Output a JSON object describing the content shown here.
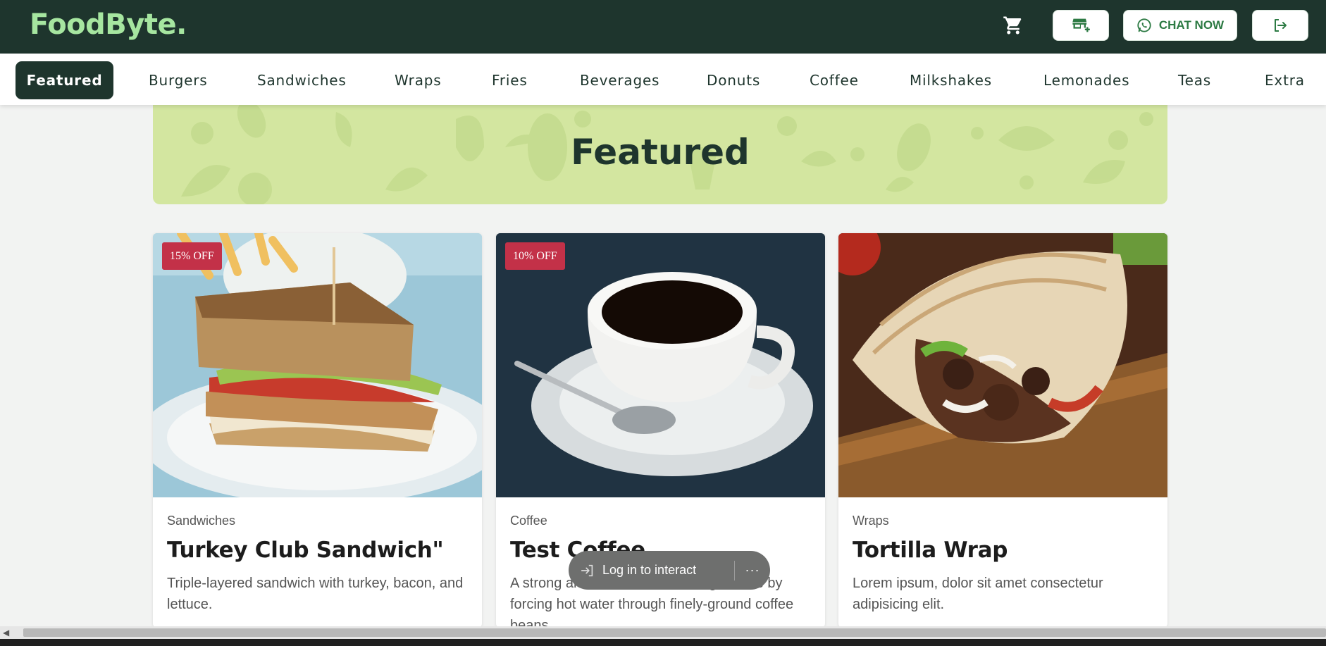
{
  "app": {
    "logo": "FoodByte.",
    "chat_label": "CHAT NOW",
    "icons": {
      "cart": "cart-icon",
      "store": "add-store-icon",
      "chat": "whatsapp-icon",
      "logout": "logout-icon"
    }
  },
  "categories": [
    {
      "label": "Featured",
      "active": true
    },
    {
      "label": "Burgers"
    },
    {
      "label": "Sandwiches"
    },
    {
      "label": "Wraps"
    },
    {
      "label": "Fries"
    },
    {
      "label": "Beverages"
    },
    {
      "label": "Donuts"
    },
    {
      "label": "Coffee"
    },
    {
      "label": "Milkshakes"
    },
    {
      "label": "Lemonades"
    },
    {
      "label": "Teas"
    },
    {
      "label": "Extra"
    }
  ],
  "hero": {
    "title": "Featured"
  },
  "products": [
    {
      "badge": "15% OFF",
      "category": "Sandwiches",
      "title": "Turkey Club Sandwich\"",
      "description": "Triple-layered sandwich with turkey, bacon, and lettuce."
    },
    {
      "badge": "10% OFF",
      "category": "Coffee",
      "title": "Test Coffee",
      "description": "A strong aromatic coffee beverage made by forcing hot water through finely-ground coffee beans."
    },
    {
      "badge": "",
      "category": "Wraps",
      "title": "Tortilla Wrap",
      "description": "Lorem ipsum, dolor sit amet consectetur adipisicing elit."
    }
  ],
  "login_prompt": {
    "label": "Log in to interact",
    "more": "···"
  },
  "colors": {
    "header_bg": "#1e352d",
    "logo": "#a6e6a0",
    "hero_bg": "#d3e6a0",
    "badge": "#c33148",
    "accent_green": "#2c7a43"
  }
}
